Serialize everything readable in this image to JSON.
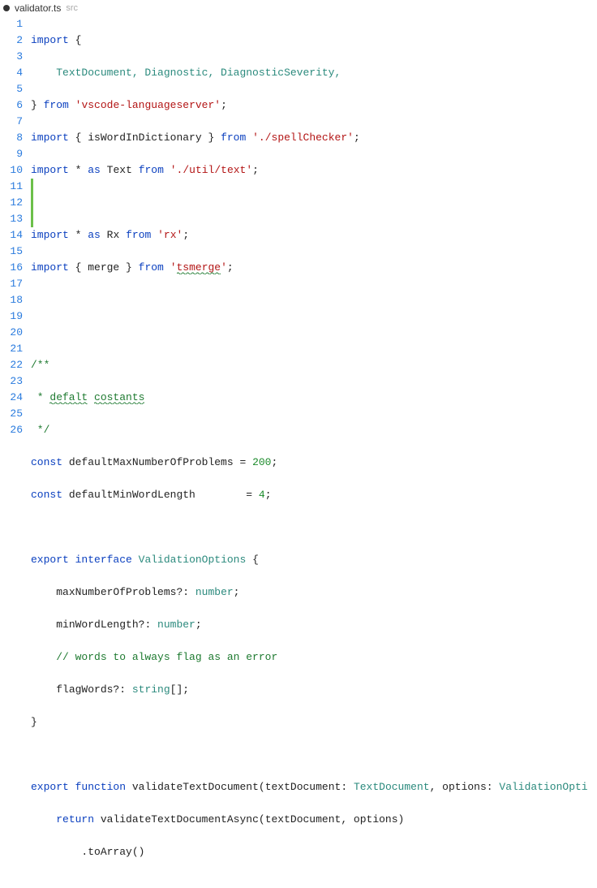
{
  "tab": {
    "dirty": true,
    "filename": "validator.ts",
    "dir": "src"
  },
  "tokens": {
    "import": "import",
    "export": "export",
    "from": "from",
    "const": "const",
    "interface": "interface",
    "function": "function",
    "return": "return",
    "as": "as"
  },
  "code": {
    "l1": {
      "obrace": "{"
    },
    "l2": {
      "txt": "TextDocument, Diagnostic, DiagnosticSeverity,"
    },
    "l3": {
      "cbrace": "}",
      "str": "'vscode-languageserver'",
      "semi": ";"
    },
    "l4": {
      "sym": "{ isWordInDictionary }",
      "str": "'./spellChecker'",
      "semi": ";"
    },
    "l5": {
      "star": "*",
      "alias": "Text",
      "str": "'./util/text'",
      "semi": ";"
    },
    "l7": {
      "star": "*",
      "alias": "Rx",
      "str": "'rx'",
      "semi": ";"
    },
    "l8": {
      "sym": "{ merge }",
      "str_open": "'",
      "str_word": "tsmerge",
      "str_close": "'",
      "semi": ";"
    },
    "l11": {
      "open": "/**"
    },
    "l12": {
      "star": " * ",
      "w1": "defalt",
      "sp": " ",
      "w2": "costants"
    },
    "l13": {
      "close": " */"
    },
    "l14": {
      "name": "defaultMaxNumberOfProblems",
      "eq": " = ",
      "val": "200",
      "semi": ";"
    },
    "l15": {
      "name": "defaultMinWordLength",
      "pad": "       ",
      "eq": " = ",
      "val": "4",
      "semi": ";"
    },
    "l17": {
      "name": "ValidationOptions",
      "obrace": " {"
    },
    "l18": {
      "name": "maxNumberOfProblems?",
      "colon": ": ",
      "type": "number",
      "semi": ";"
    },
    "l19": {
      "name": "minWordLength?",
      "colon": ": ",
      "type": "number",
      "semi": ";"
    },
    "l20": {
      "txt": "// words to always flag as an error"
    },
    "l21": {
      "name": "flagWords?",
      "colon": ": ",
      "type": "string",
      "arr": "[]",
      "semi": ";"
    },
    "l22": {
      "cbrace": "}"
    },
    "l24": {
      "fn": "validateTextDocument",
      "open": "(",
      "p1": "textDocument",
      "c1": ": ",
      "t1": "TextDocument",
      "comma": ", ",
      "p2": "options",
      "c2": ": ",
      "t2": "ValidationOpti"
    },
    "l25": {
      "fn": "validateTextDocumentAsync",
      "open": "(",
      "args": "textDocument, options",
      "close": ")"
    },
    "l26": {
      "method": ".toArray()"
    }
  },
  "line_count": 26
}
